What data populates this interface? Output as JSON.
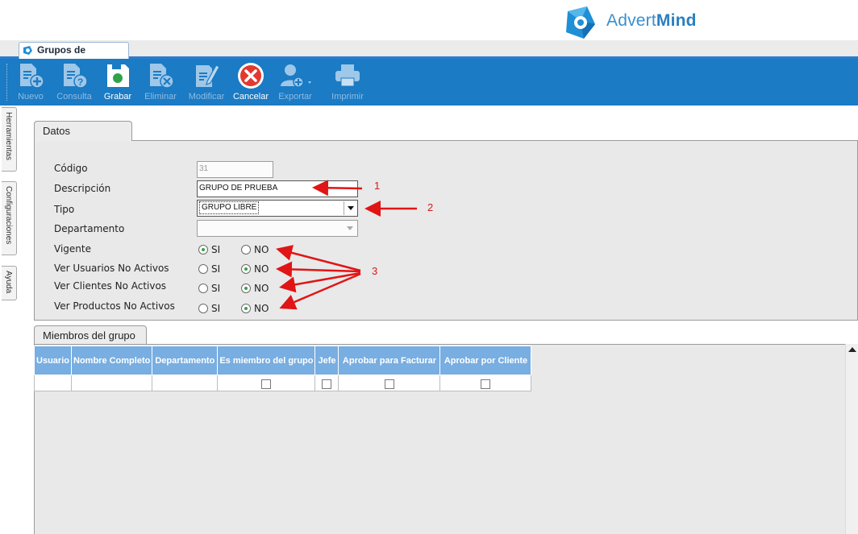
{
  "brand": {
    "name_light": "Advert",
    "name_bold": "Mind"
  },
  "document_tab": {
    "label": "Grupos de Atención"
  },
  "toolbar": {
    "nuevo": "Nuevo",
    "consulta": "Consulta",
    "grabar": "Grabar",
    "eliminar": "Eliminar",
    "modificar": "Modificar",
    "cancelar": "Cancelar",
    "exportar": "Exportar",
    "imprimir": "Imprimir",
    "enabled_color": "#ffffff",
    "disabled_color": "#8dbce4",
    "bar_color": "#1b7bc4"
  },
  "side_tabs": {
    "herramientas": "Herramientas",
    "configuraciones": "Configuraciones",
    "ayuda": "Ayuda"
  },
  "datos_principales": {
    "tab_label": "Datos Principales",
    "codigo_label": "Código",
    "codigo_value": "31",
    "descripcion_label": "Descripción",
    "descripcion_value": "GRUPO DE PRUEBA",
    "tipo_label": "Tipo",
    "tipo_value": "GRUPO LIBRE",
    "departamento_label": "Departamento",
    "departamento_value": "",
    "vigente_label": "Vigente",
    "ver_usuarios_label": "Ver Usuarios No Activos",
    "ver_clientes_label": "Ver Clientes No Activos",
    "ver_productos_label": "Ver Productos No Activos",
    "si_label": "SI",
    "no_label": "NO",
    "vigente_selected": "SI",
    "ver_usuarios_selected": "NO",
    "ver_clientes_selected": "NO",
    "ver_productos_selected": "NO"
  },
  "miembros": {
    "tab_label": "Miembros del grupo",
    "columns": [
      "Usuario",
      "Nombre Completo",
      "Departamento",
      "Es miembro del grupo",
      "Jefe",
      "Aprobar para Facturar",
      "Aprobar por Cliente"
    ]
  },
  "annotations": {
    "a1": "1",
    "a2": "2",
    "a3": "3",
    "color": "#e01515"
  }
}
